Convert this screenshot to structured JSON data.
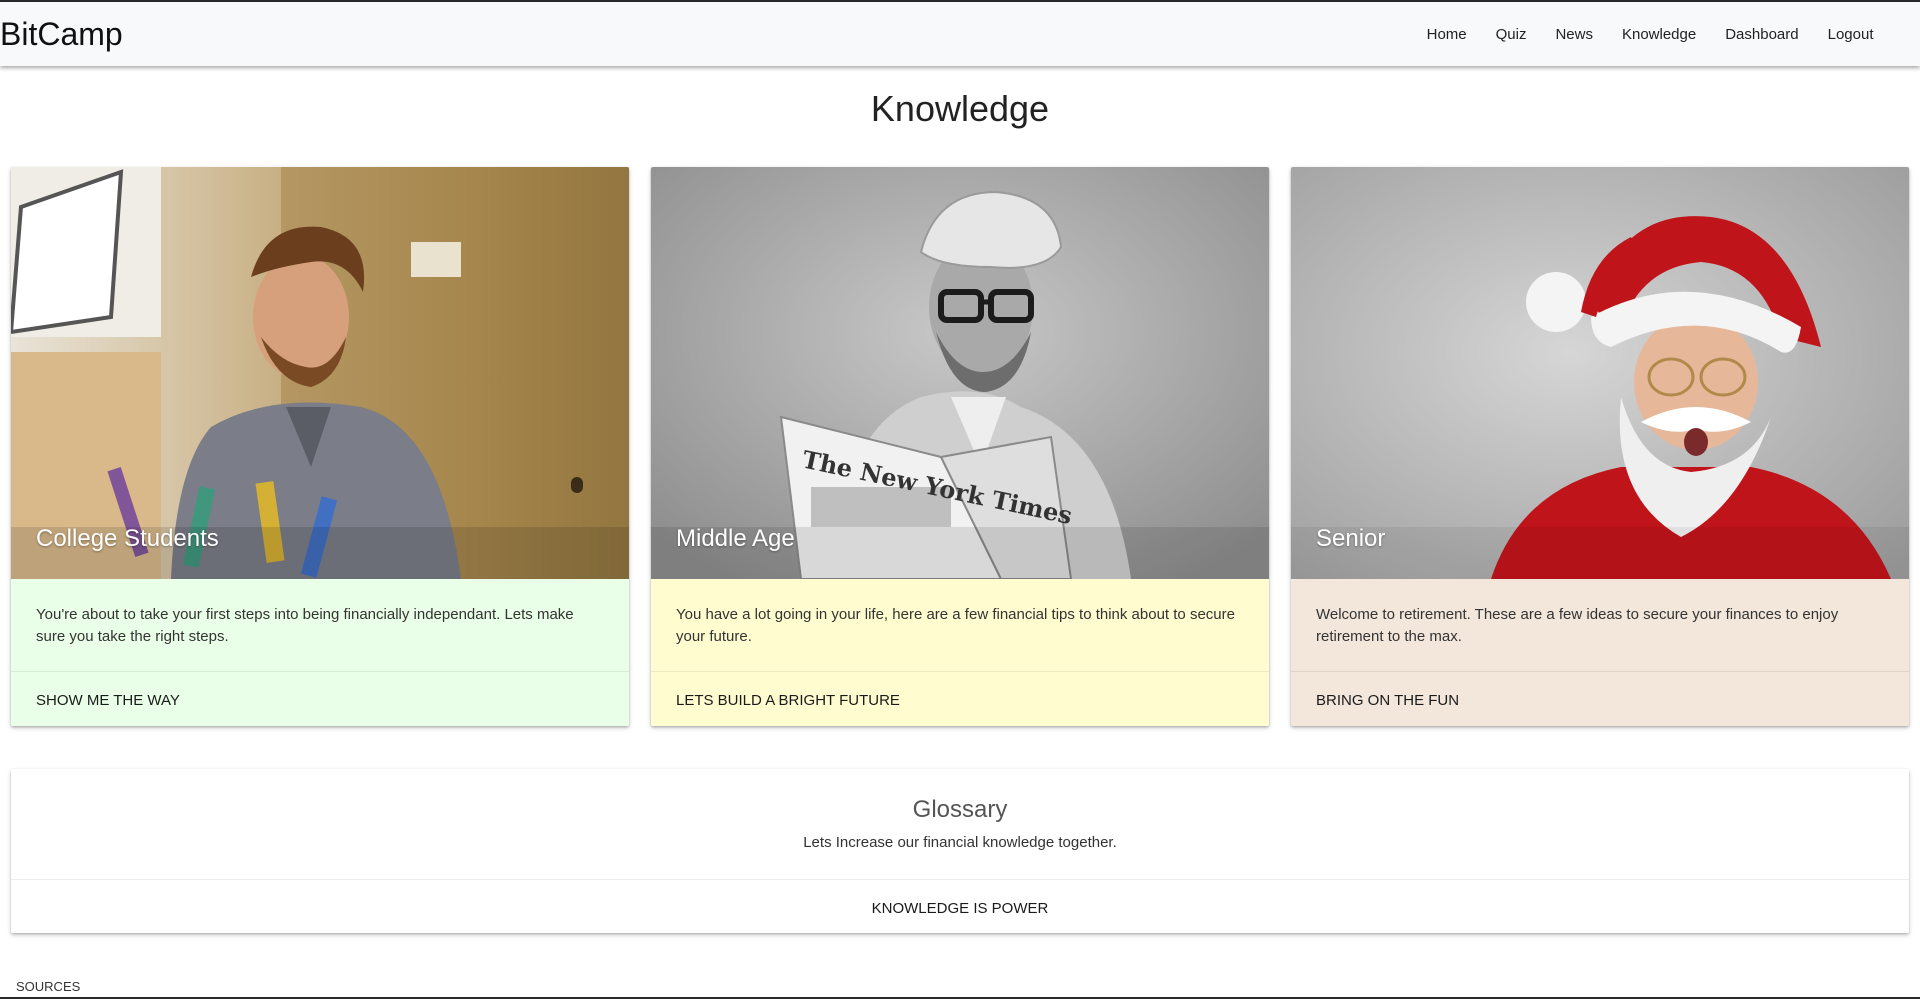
{
  "navbar": {
    "brand": "BitCamp",
    "links": [
      "Home",
      "Quiz",
      "News",
      "Knowledge",
      "Dashboard",
      "Logout"
    ]
  },
  "page_title": "Knowledge",
  "cards": [
    {
      "title": "College Students",
      "text": "You're about to take your first steps into being financially independant. Lets make sure you take the right steps.",
      "action": "SHOW ME THE WAY",
      "color": "#eaffe8",
      "image_icon": "man-at-desk-photo"
    },
    {
      "title": "Middle Age",
      "text": "You have a lot going in your life, here are a few financial tips to think about to secure your future.",
      "action": "LETS BUILD A BRIGHT FUTURE",
      "color": "#fffdd0",
      "image_icon": "man-reading-newspaper-photo"
    },
    {
      "title": "Senior",
      "text": "Welcome to retirement. These are a few ideas to secure your finances to enjoy retirement to the max.",
      "action": "BRING ON THE FUN",
      "color": "#f3e7dc",
      "image_icon": "santa-claus-photo"
    }
  ],
  "newspaper_masthead": "The New York Times",
  "glossary": {
    "title": "Glossary",
    "text": "Lets Increase our financial knowledge together.",
    "action": "KNOWLEDGE IS POWER"
  },
  "footer": {
    "sources_label": "SOURCES"
  }
}
